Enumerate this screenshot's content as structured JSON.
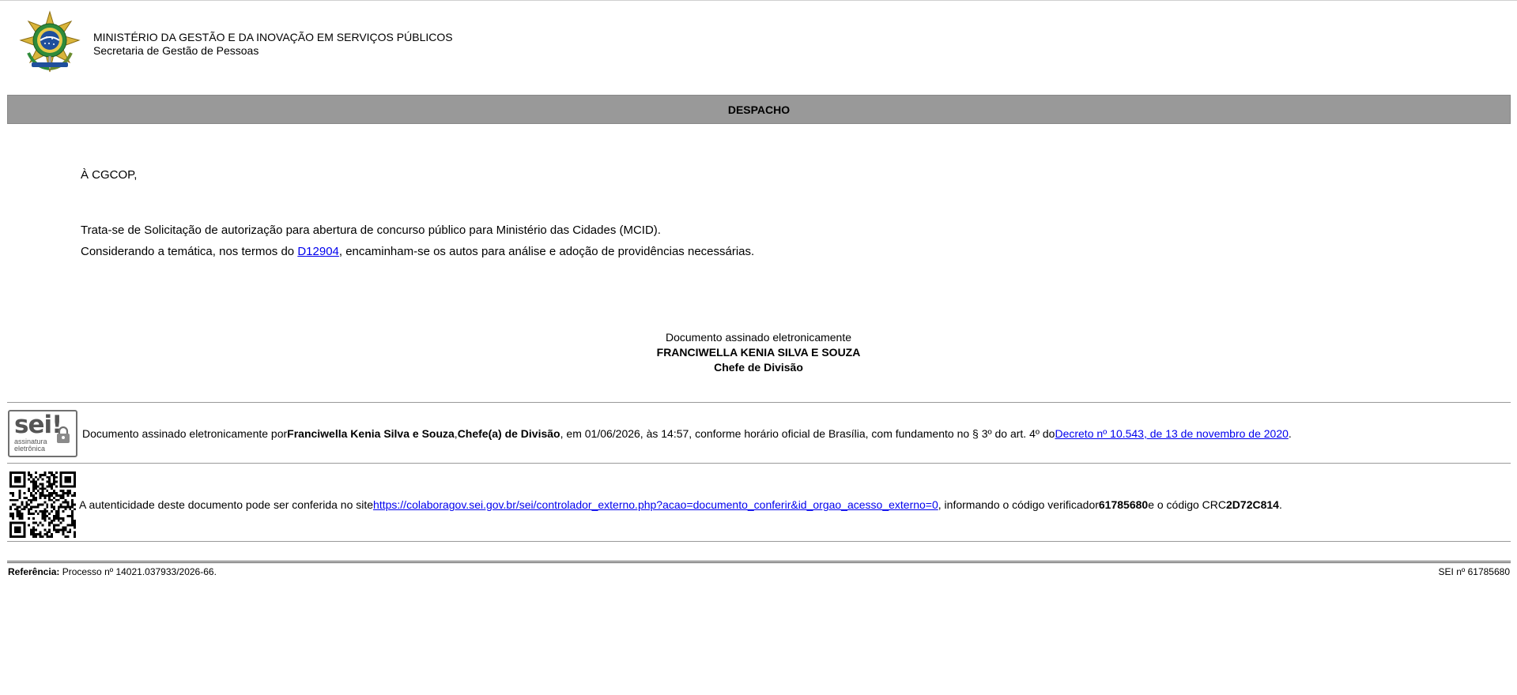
{
  "header": {
    "ministry": "MINISTÉRIO DA GESTÃO E DA INOVAÇÃO EM SERVIÇOS PÚBLICOS",
    "secretariat": "Secretaria de Gestão de Pessoas",
    "emblem_icon": "brazil-coat-of-arms-icon"
  },
  "document": {
    "title": "DESPACHO",
    "addressee": "À CGCOP,",
    "paragraph1": "Trata-se de Solicitação de autorização para abertura de concurso público para Ministério das Cidades (MCID).",
    "paragraph2_before": "Considerando a temática, nos termos do ",
    "paragraph2_link": "D12904",
    "paragraph2_after": ", encaminham-se os autos para análise e adoção de providências necessárias."
  },
  "signature": {
    "line1": "Documento assinado eletronicamente",
    "name": "FRANCIWELLA KENIA SILVA E SOUZA",
    "role": "Chefe de Divisão"
  },
  "electronic_signature": {
    "logo_word": "sei!",
    "logo_sub1": "assinatura",
    "logo_sub2": "eletrônica",
    "text_before": "Documento assinado eletronicamente por ",
    "signer": "Franciwella Kenia Silva e Souza",
    "comma": ", ",
    "signer_role": "Chefe(a) de Divisão",
    "text_middle": ", em 01/06/2026, às 14:57, conforme horário oficial de Brasília, com fundamento no § 3º do art. 4º do ",
    "decree_link": "Decreto nº 10.543, de 13 de novembro de 2020",
    "text_end": "."
  },
  "authenticity": {
    "text_before": "A autenticidade deste documento pode ser conferida no site ",
    "url": "https://colaboragov.sei.gov.br/sei/controlador_externo.php?acao=documento_conferir&id_orgao_acesso_externo=0",
    "text_middle": ", informando o código verificador ",
    "verifier_code": "61785680",
    "text_crc": " e o código CRC ",
    "crc_code": "2D72C814",
    "text_end": "."
  },
  "footer": {
    "reference_label": "Referência:",
    "reference_value": " Processo nº 14021.037933/2026-66.",
    "sei_number": "SEI nº 61785680"
  }
}
